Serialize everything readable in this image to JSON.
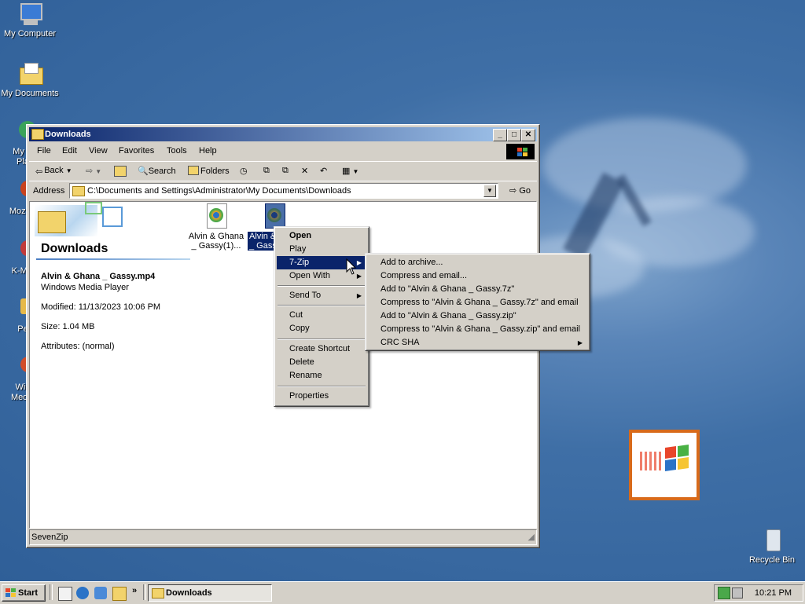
{
  "desktop": {
    "icons": [
      {
        "label": "My Computer"
      },
      {
        "label": "My Documents"
      },
      {
        "label": "My N\nPla"
      },
      {
        "label": "Mozilla"
      },
      {
        "label": "K-Mel"
      },
      {
        "label": "Pe"
      },
      {
        "label": "Win\nMedia"
      },
      {
        "label": "Recycle Bin"
      }
    ]
  },
  "window": {
    "title": "Downloads",
    "controls": {
      "minimize": "_",
      "maximize": "□",
      "close": "✕"
    },
    "menu": [
      "File",
      "Edit",
      "View",
      "Favorites",
      "Tools",
      "Help"
    ],
    "toolbar": {
      "back": "Back",
      "search": "Search",
      "folders": "Folders"
    },
    "address": {
      "label": "Address",
      "value": "C:\\Documents and Settings\\Administrator\\My Documents\\Downloads",
      "go": "Go"
    },
    "panel": {
      "folder_name": "Downloads",
      "file_name": "Alvin & Ghana _ Gassy.mp4",
      "file_type": "Windows Media Player",
      "modified": "Modified: 11/13/2023 10:06 PM",
      "size": "Size: 1.04 MB",
      "attributes": "Attributes: (normal)"
    },
    "files": [
      {
        "label_line1": "Alvin & Ghana",
        "label_line2": "_ Gassy(1)...",
        "selected": false
      },
      {
        "label_line1": "Alvin &",
        "label_line2": "_ Gass",
        "selected": true
      }
    ],
    "status": "SevenZip"
  },
  "context_menu": {
    "items": [
      {
        "label": "Open",
        "bold": true
      },
      {
        "label": "Play"
      },
      {
        "label": "7-Zip",
        "submenu": true,
        "selected": true
      },
      {
        "label": "Open With",
        "submenu": true
      },
      {
        "label": "Send To",
        "submenu": true
      },
      {
        "label": "Cut"
      },
      {
        "label": "Copy"
      },
      {
        "label": "Create Shortcut"
      },
      {
        "label": "Delete"
      },
      {
        "label": "Rename"
      },
      {
        "label": "Properties"
      }
    ]
  },
  "zip_submenu": {
    "items": [
      {
        "label": "Add to archive..."
      },
      {
        "label": "Compress and email..."
      },
      {
        "label": "Add to \"Alvin & Ghana _ Gassy.7z\""
      },
      {
        "label": "Compress to \"Alvin & Ghana _ Gassy.7z\" and email"
      },
      {
        "label": "Add to \"Alvin & Ghana _ Gassy.zip\""
      },
      {
        "label": "Compress to \"Alvin & Ghana _ Gassy.zip\" and email"
      },
      {
        "label": "CRC SHA",
        "submenu": true
      }
    ]
  },
  "taskbar": {
    "start": "Start",
    "task": "Downloads",
    "clock": "10:21 PM"
  },
  "colors": {
    "selection": "#0a246a",
    "titlebar_start": "#0a246a",
    "titlebar_end": "#a6caf0",
    "chrome": "#d4d0c8"
  }
}
